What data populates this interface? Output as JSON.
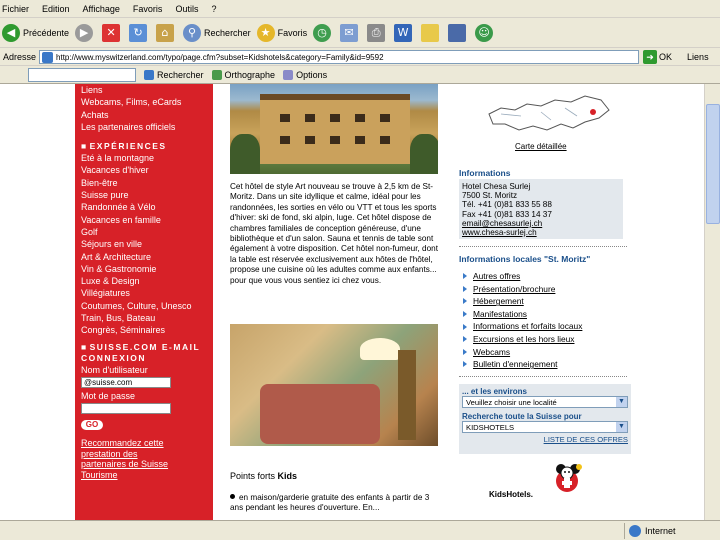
{
  "menubar": {
    "items": [
      "Fichier",
      "Edition",
      "Affichage",
      "Favoris",
      "Outils",
      "?"
    ]
  },
  "toolbar": {
    "back_label": "Précédente",
    "search_label": "Rechercher",
    "favorites_label": "Favoris"
  },
  "addressbar": {
    "label": "Adresse",
    "url": "http://www.myswitzerland.com/typo/page.cfm?subset=Kidshotels&category=Family&id=9592",
    "go_label": "OK",
    "links_label": "Liens"
  },
  "googlebar": {
    "search_button": "Rechercher",
    "spell_label": "Orthographe",
    "options_label": "Options"
  },
  "leftnav": {
    "top_links": [
      "Liens",
      "Webcams, Films, eCards",
      "Achats",
      "Les partenaires officiels"
    ],
    "experiences_heading": "EXPÉRIENCES",
    "experience_links": [
      "Eté à la montagne",
      "Vacances d'hiver",
      "Bien-être",
      "Suisse pure",
      "Randonnée à Vélo",
      "Vacances en famille",
      "Golf",
      "Séjours en ville",
      "Art & Architecture",
      "Vin & Gastronomie",
      "Luxe & Design",
      "Villégiatures",
      "Coutumes, Culture, Unesco",
      "Train, Bus, Bateau",
      "Congrès, Séminaires"
    ],
    "login_heading_1": "SUISSE.COM E-MAIL",
    "login_heading_2": "CONNEXION",
    "username_label": "Nom d'utilisateur",
    "username_value": "@suisse.com",
    "password_label": "Mot de passe",
    "go_button": "GO",
    "recommend_text": "Recommandez cette prestation des partenaires de Suisse Tourisme"
  },
  "center": {
    "hotel_text": "Cet hôtel de style Art nouveau se trouve à 2,5 km de St-Moritz. Dans un site idyllique et calme, idéal pour les randonnées, les sorties en vélo ou VTT et tous les sports d'hiver: ski de fond, ski alpin, luge. Cet hôtel dispose de chambres familiales de conception généreuse, d'une bibliothèque et d'un salon. Sauna et tennis de table sont également à votre disposition. Cet hôtel non-fumeur, dont la table est réservée exclusivement aux hôtes de l'hôtel, propose une cuisine où les adultes comme aux enfants... pour que vous vous sentiez ici chez vous.",
    "kids_title_prefix": "Points forts",
    "kids_title_bold": "Kids",
    "kids_text": "en maison/garderie gratuite des enfants à partir de 3 ans pendant les heures d'ouverture. En..."
  },
  "right": {
    "map_link": "Carte détaillée",
    "info_heading": "Informations",
    "info_lines": [
      "Hotel Chesa Surlej",
      "7500 St. Moritz",
      "Tél. +41 (0)81 833 55 88",
      "Fax +41 (0)81 833 14 37",
      "email@chesasurlej.ch",
      "www.chesa-surlej.ch"
    ],
    "local_heading": "Informations locales \"St. Moritz\"",
    "local_items": [
      "Autres offres",
      "Présentation/brochure",
      "Hébergement",
      "Manifestations",
      "Informations et forfaits locaux",
      "Excursions et les hors lieux",
      "Webcams",
      "Bulletin d'enneigement"
    ],
    "env_label": "... et les environs",
    "env_select": "Veuillez choisir une localité",
    "search_label": "Recherche toute la Suisse pour",
    "search_select": "KIDSHOTELS",
    "list_link": "LISTE DE CES OFFRES",
    "kidshotels_label": "KidsHotels."
  },
  "statusbar": {
    "zone_label": "Internet"
  },
  "colors": {
    "nav_red": "#d72128",
    "panel_bg": "#e3e8ed",
    "heading_blue": "#1a4f8a",
    "chrome_bg": "#ece9d8"
  }
}
